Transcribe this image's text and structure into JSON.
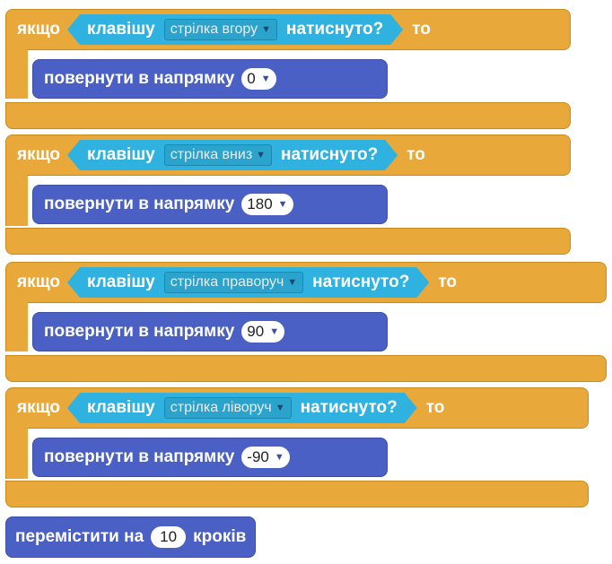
{
  "blocks": [
    {
      "if_label": "якщо",
      "key_label": "клавішу",
      "key_option": "стрілка вгору",
      "pressed_label": "натиснуто?",
      "then_label": "то",
      "turn_label": "повернути в напрямку",
      "turn_value": "0"
    },
    {
      "if_label": "якщо",
      "key_label": "клавішу",
      "key_option": "стрілка вниз",
      "pressed_label": "натиснуто?",
      "then_label": "то",
      "turn_label": "повернути в напрямку",
      "turn_value": "180"
    },
    {
      "if_label": "якщо",
      "key_label": "клавішу",
      "key_option": "стрілка праворуч",
      "pressed_label": "натиснуто?",
      "then_label": "то",
      "turn_label": "повернути в напрямку",
      "turn_value": "90"
    },
    {
      "if_label": "якщо",
      "key_label": "клавішу",
      "key_option": "стрілка ліворуч",
      "pressed_label": "натиснуто?",
      "then_label": "то",
      "turn_label": "повернути в напрямку",
      "turn_value": "-90"
    }
  ],
  "move": {
    "label": "перемістити на",
    "steps": "10",
    "unit": "кроків"
  },
  "colors": {
    "control": "#e9a93a",
    "sensing": "#2fb2df",
    "motion": "#4b60c4"
  },
  "icons": {
    "dropdown": "chevron-down-icon"
  }
}
